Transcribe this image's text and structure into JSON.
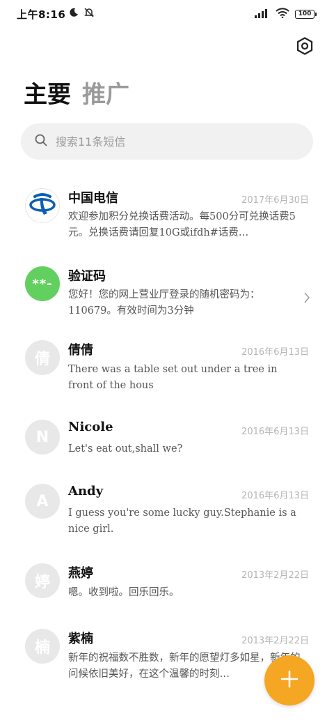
{
  "status_bar": {
    "time": "上午8:16",
    "battery": "100"
  },
  "header": {
    "title_main": "主要",
    "title_secondary": "推广"
  },
  "search": {
    "placeholder": "搜索11条短信"
  },
  "messages": [
    {
      "name": "中国电信",
      "date": "2017年6月30日",
      "preview": "欢迎参加积分兑换话费活动。每500分可兑换话费5元。兑换话费请回复10G或ifdh#话费…",
      "avatar": "china-telecom-logo"
    },
    {
      "name": "验证码",
      "date": "",
      "preview": "您好！您的网上营业厅登录的随机密码为：110679。有效时间为3分钟",
      "avatar_text": "**-"
    },
    {
      "name": "倩倩",
      "date": "2016年6月13日",
      "preview": "There was a table set out under a tree in front of the hous",
      "avatar_text": "倩"
    },
    {
      "name": "Nicole",
      "date": "2016年6月13日",
      "preview": "Let's eat out,shall we?",
      "avatar_text": "N"
    },
    {
      "name": "Andy",
      "date": "2016年6月13日",
      "preview": "I guess you're some lucky guy.Stephanie is a nice girl.",
      "avatar_text": "A"
    },
    {
      "name": "燕婷",
      "date": "2013年2月22日",
      "preview": "嗯。收到啦。回乐回乐。",
      "avatar_text": "婷"
    },
    {
      "name": "紫楠",
      "date": "2013年2月22日",
      "preview": "新年的祝福数不胜数，新年的愿望灯多如星，新年的问候依旧美好，在这个温馨的时刻…",
      "avatar_text": "楠"
    }
  ],
  "colors": {
    "accent": "#f5a623",
    "verify_avatar": "#62d05f",
    "telecom_blue": "#0a5fb4"
  }
}
